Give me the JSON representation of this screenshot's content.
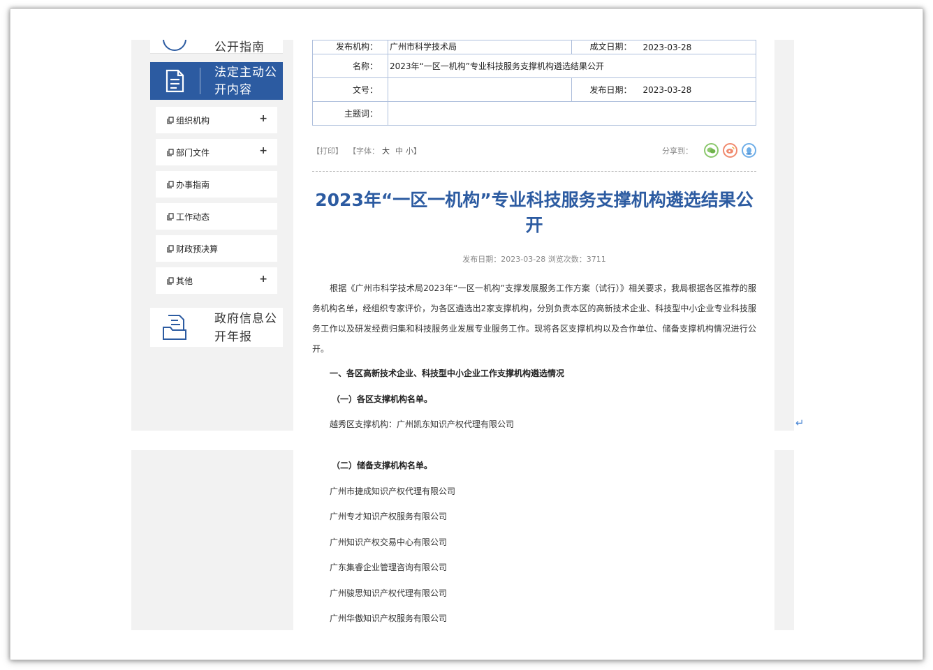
{
  "sidebar": {
    "top_label": "公开指南",
    "main_label": "法定主动公开内容",
    "items": [
      {
        "label": "组织机构",
        "expandable": true
      },
      {
        "label": "部门文件",
        "expandable": true
      },
      {
        "label": "办事指南",
        "expandable": false
      },
      {
        "label": "工作动态",
        "expandable": false
      },
      {
        "label": "财政预决算",
        "expandable": false
      },
      {
        "label": "其他",
        "expandable": true
      }
    ],
    "plus": "+",
    "report_label": "政府信息公开年报"
  },
  "info": {
    "publisher_key": "发布机构：",
    "publisher_value": "广州市科学技术局",
    "created_key": "成文日期：",
    "created_value": "2023-03-28",
    "name_key": "名称：",
    "name_value": "2023年“一区一机构”专业科技服务支撑机构遴选结果公开",
    "docno_key": "文号：",
    "docno_value": "",
    "pub_key": "发布日期：",
    "pub_value": "2023-03-28",
    "subject_key": "主题词：",
    "subject_value": ""
  },
  "tools": {
    "print": "【打印】",
    "font_label": "【字体：",
    "font_large": "大",
    "font_medium": "中",
    "font_small": "小】",
    "share_label": "分享到："
  },
  "article": {
    "title": "2023年“一区一机构”专业科技服务支撑机构遴选结果公开",
    "meta": "发布日期：2023-03-28  浏览次数：3711",
    "intro": "根据《广州市科学技术局2023年“一区一机构”支撑发展服务工作方案（试行）》相关要求，我局根据各区推荐的服务机构名单，经组织专家评价，为各区遴选出2家支撑机构，分别负责本区的高新技术企业、科技型中小企业专业科技服务工作以及研发经费归集和科技服务业发展专业服务工作。现将各区支撑机构以及合作单位、储备支撑机构情况进行公开。",
    "section1": "一、各区高新技术企业、科技型中小企业工作支撑机构遴选情况",
    "sub1": "（一）各区支撑机构名单。",
    "yuexiu": "越秀区支撑机构：广州凯东知识产权代理有限公司",
    "sub2": "（二）储备支撑机构名单。",
    "reserves": [
      "广州市捷成知识产权代理有限公司",
      "广州专才知识产权服务有限公司",
      "广州知识产权交易中心有限公司",
      "广东集睿企业管理咨询有限公司",
      "广州骏思知识产权代理有限公司",
      "广州华傲知识产权服务有限公司"
    ],
    "return_mark": "↵"
  }
}
